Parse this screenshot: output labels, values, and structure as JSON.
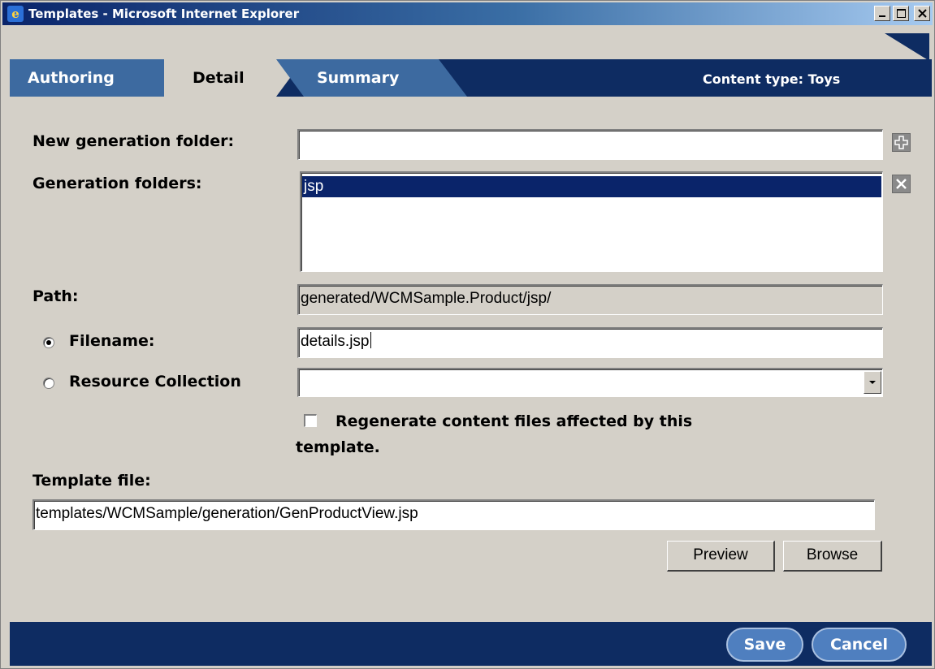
{
  "window": {
    "title": "Templates - Microsoft Internet Explorer",
    "app_icon": "ie-icon",
    "controls": [
      "minimize-button",
      "maximize-button",
      "close-button"
    ]
  },
  "tabs": [
    {
      "label": "Authoring",
      "active": false
    },
    {
      "label": "Detail",
      "active": true
    },
    {
      "label": "Summary",
      "active": false
    }
  ],
  "content_type": "Content type: Toys",
  "form": {
    "new_generation_folder": {
      "label": "New generation folder:",
      "value": ""
    },
    "generation_folders": {
      "label": "Generation folders:",
      "items": [
        "jsp"
      ],
      "selected": "jsp"
    },
    "path": {
      "label": "Path:",
      "value": "generated/WCMSample.Product/jsp/"
    },
    "filename": {
      "label": "Filename:",
      "value": "details.jsp",
      "selected": true
    },
    "resource_collection": {
      "label": "Resource Collection",
      "value": "",
      "selected": false
    },
    "regenerate": {
      "label_line1": "Regenerate content files affected by this",
      "label_line2": "template.",
      "checked": false
    },
    "template_file": {
      "label": "Template file:",
      "value": "templates/WCMSample/generation/GenProductView.jsp"
    },
    "preview_label": "Preview",
    "browse_label": "Browse"
  },
  "footer": {
    "save_label": "Save",
    "cancel_label": "Cancel"
  },
  "colors": {
    "nav_dark": "#0e2c62",
    "tab_blue": "#3d6aa0",
    "selection": "#0a246a",
    "dialog_gray": "#d4d0c8"
  }
}
